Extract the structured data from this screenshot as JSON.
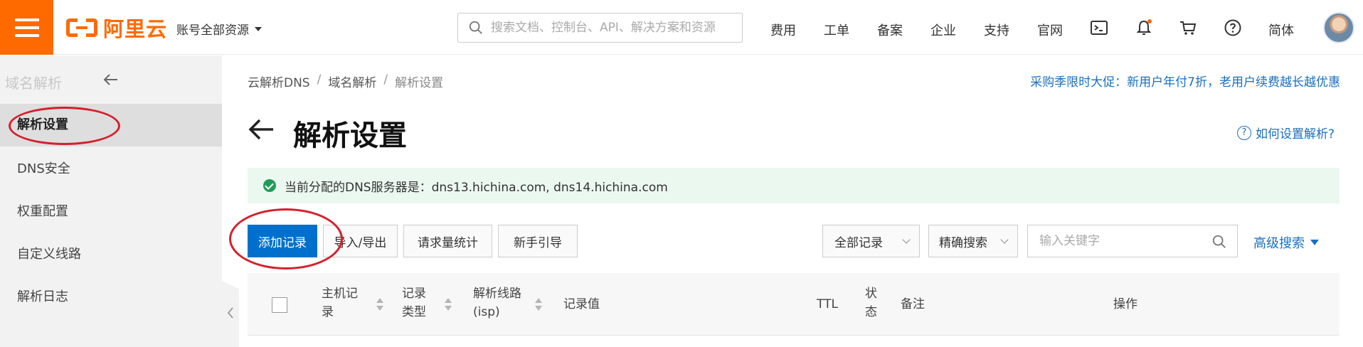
{
  "topbar": {
    "logo_text": "阿里云",
    "account_scope": "账号全部资源",
    "search_placeholder": "搜索文档、控制台、API、解决方案和资源",
    "nav": [
      "费用",
      "工单",
      "备案",
      "企业",
      "支持",
      "官网"
    ],
    "language": "简体"
  },
  "sidebar": {
    "title": "域名解析",
    "items": [
      "解析设置",
      "DNS安全",
      "权重配置",
      "自定义线路",
      "解析日志"
    ],
    "active_index": 0
  },
  "breadcrumb": [
    "云解析DNS",
    "域名解析",
    "解析设置"
  ],
  "promo": "采购季限时大促：新用户年付7折，老用户续费越长越优惠",
  "page_title": "解析设置",
  "help_link": "如何设置解析?",
  "notice": "当前分配的DNS服务器是：dns13.hichina.com, dns14.hichina.com",
  "toolbar": {
    "add": "添加记录",
    "import_export": "导入/导出",
    "stats": "请求量统计",
    "guide": "新手引导",
    "filter_all": "全部记录",
    "search_mode": "精确搜索",
    "keyword_placeholder": "输入关键字",
    "advanced": "高级搜索"
  },
  "table": {
    "headers": {
      "host_line1": "主机记",
      "host_line2": "录",
      "type_line1": "记录",
      "type_line2": "类型",
      "line_line1": "解析线路",
      "line_line2": "(isp)",
      "value": "记录值",
      "ttl": "TTL",
      "status_line1": "状",
      "status_line2": "态",
      "remark": "备注",
      "action": "操作"
    }
  },
  "colors": {
    "brand_orange": "#ff6a00",
    "primary_blue": "#0070cc",
    "link_blue": "#1a6fbf",
    "annotation_red": "#d61f2c",
    "success_green": "#1f9d55"
  }
}
